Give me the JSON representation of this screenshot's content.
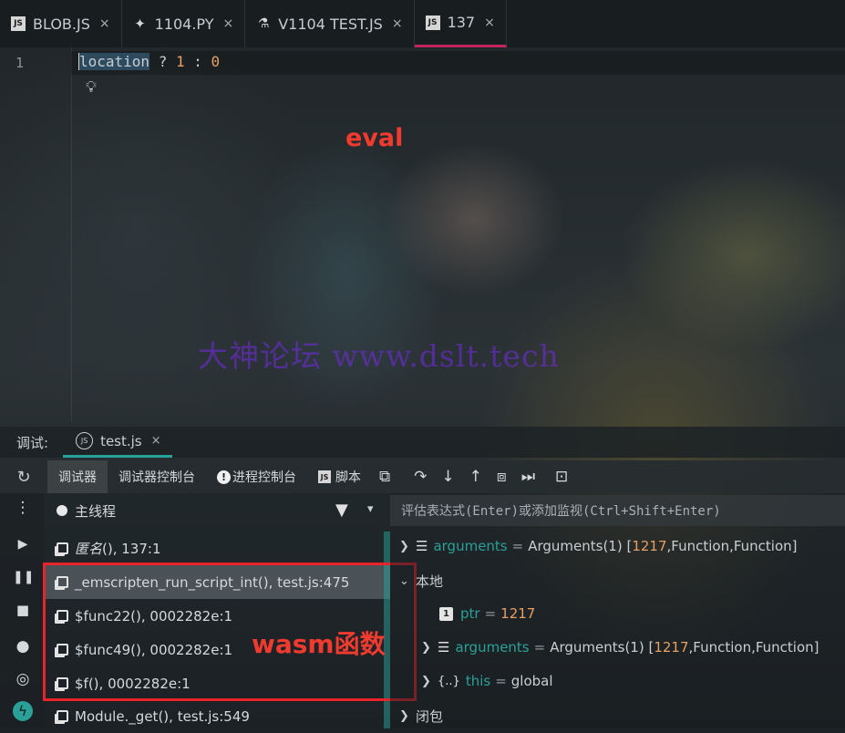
{
  "tabs": [
    {
      "label": "BLOB.JS",
      "icon": "js-file-icon",
      "close": "×"
    },
    {
      "label": "1104.PY",
      "icon": "python-file-icon",
      "close": "×"
    },
    {
      "label": "V1104 TEST.JS",
      "icon": "js-test-file-icon",
      "close": "×"
    },
    {
      "label": "137",
      "icon": "js-file-icon",
      "close": "×",
      "active": true
    }
  ],
  "editor": {
    "line_number": "1",
    "code_ident": "location",
    "code_op1": " ? ",
    "code_num1": "1",
    "code_op2": " : ",
    "code_num2": "0"
  },
  "annotations": {
    "eval_label": "eval",
    "watermark": "大神论坛  www.dslt.tech",
    "wasm_label": "wasm函数"
  },
  "debug": {
    "label": "调试:",
    "file_tab": "test.js",
    "file_tab_close": "×",
    "toolbar": {
      "debugger": "调试器",
      "debugger_console": "调试器控制台",
      "process_console": "进程控制台",
      "script": "脚本"
    },
    "thread": "主线程",
    "frames": [
      {
        "name": "匿名",
        "suffix": "(), 137:1",
        "italic": true
      },
      {
        "name": "_emscripten_run_script_int",
        "suffix": "(), test.js:475",
        "selected": true
      },
      {
        "name": "$func22",
        "suffix": "(), 0002282e:1"
      },
      {
        "name": "$func49",
        "suffix": "(), 0002282e:1"
      },
      {
        "name": "$f",
        "suffix": "(), 0002282e:1"
      },
      {
        "name": "Module._get",
        "suffix": "(), test.js:549"
      }
    ],
    "eval_placeholder": "评估表达式(Enter)或添加监视(Ctrl+Shift+Enter)",
    "vars": {
      "arguments1_name": "arguments",
      "arguments1_value": "Arguments(1) [",
      "arguments1_num": "1217",
      "arguments1_rest": ",Function,Function]",
      "local_section": "本地",
      "ptr_name": "ptr",
      "ptr_value": "1217",
      "arguments2_name": "arguments",
      "arguments2_value": "Arguments(1) [",
      "arguments2_num": "1217",
      "arguments2_rest": ",Function,Function]",
      "this_name": "this",
      "this_value": "global",
      "closure_section": "闭包"
    }
  },
  "colors": {
    "accent_tab": "#c2255c",
    "debug_accent": "#2aa198",
    "annotation_red": "#f23a2e",
    "watermark": "#6f2bd8",
    "number": "#e8a063"
  }
}
